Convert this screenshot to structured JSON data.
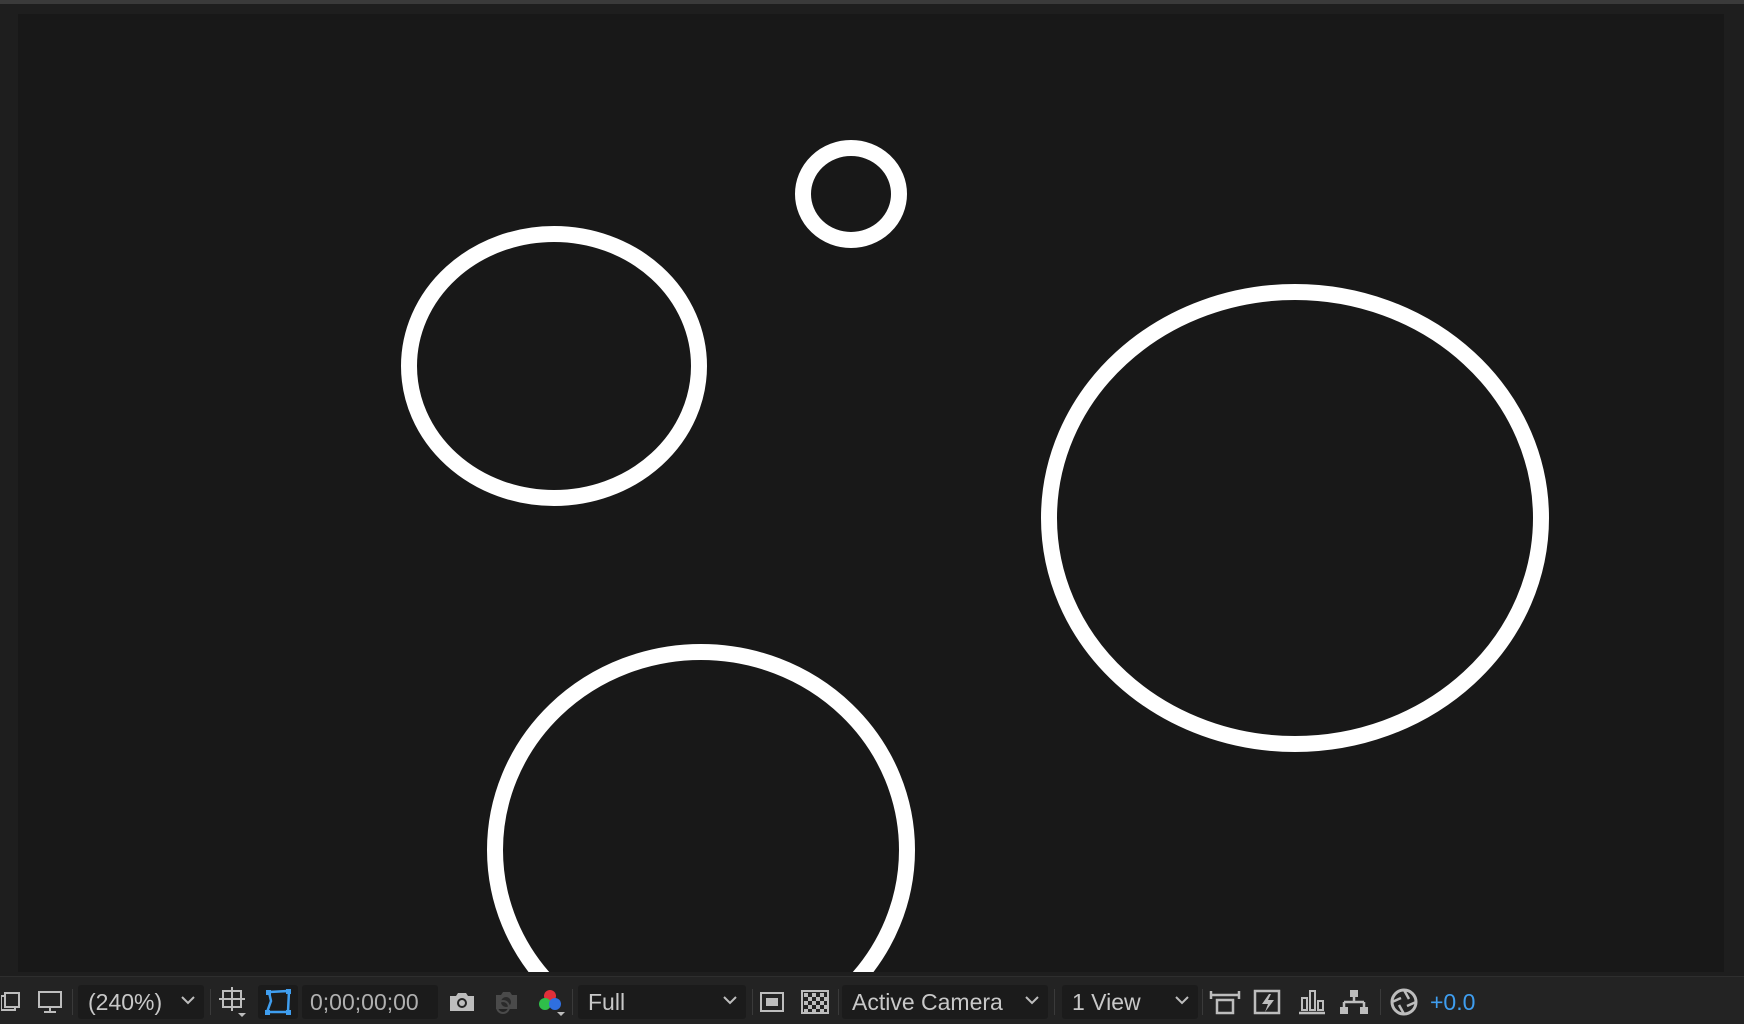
{
  "viewer": {
    "background": "#181818",
    "ring_color": "#ffffff"
  },
  "toolbar": {
    "zoom_value": "(240%)",
    "timecode": "0;00;00;00",
    "resolution_value": "Full",
    "camera_value": "Active Camera",
    "view_layout_value": "1 View",
    "exposure_value": "+0.0",
    "accent_color": "#3f9ef0",
    "icons": [
      "preview-panel-icon",
      "display-monitor-icon",
      "region-of-interest-icon",
      "mask-path-visibility-icon",
      "snapshot-camera-icon",
      "show-snapshot-icon",
      "color-channels-icon",
      "fast-previews-icon",
      "transparency-grid-icon",
      "reset-view-icon",
      "flowchart-icon",
      "timeline-icon",
      "composition-flowchart-icon",
      "exposure-shutter-icon"
    ]
  }
}
